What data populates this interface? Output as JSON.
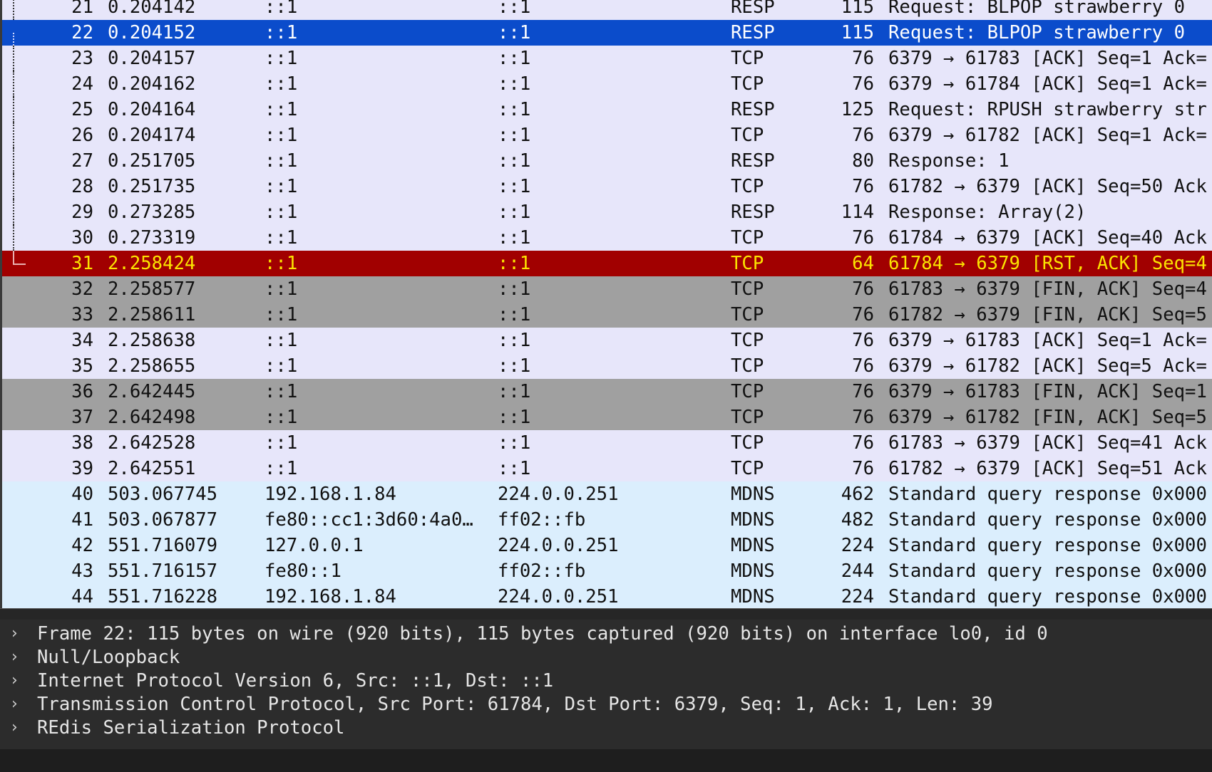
{
  "packets": [
    {
      "no": "21",
      "time": "0.204142",
      "source": "::1",
      "destination": "::1",
      "protocol": "RESP",
      "length": "115",
      "info": "Request: BLPOP strawberry 0",
      "style": "normal"
    },
    {
      "no": "22",
      "time": "0.204152",
      "source": "::1",
      "destination": "::1",
      "protocol": "RESP",
      "length": "115",
      "info": "Request: BLPOP strawberry 0",
      "style": "selected"
    },
    {
      "no": "23",
      "time": "0.204157",
      "source": "::1",
      "destination": "::1",
      "protocol": "TCP",
      "length": "76",
      "info": "6379 → 61783 [ACK] Seq=1 Ack=",
      "style": "normal"
    },
    {
      "no": "24",
      "time": "0.204162",
      "source": "::1",
      "destination": "::1",
      "protocol": "TCP",
      "length": "76",
      "info": "6379 → 61784 [ACK] Seq=1 Ack=",
      "style": "normal"
    },
    {
      "no": "25",
      "time": "0.204164",
      "source": "::1",
      "destination": "::1",
      "protocol": "RESP",
      "length": "125",
      "info": "Request: RPUSH strawberry str",
      "style": "normal"
    },
    {
      "no": "26",
      "time": "0.204174",
      "source": "::1",
      "destination": "::1",
      "protocol": "TCP",
      "length": "76",
      "info": "6379 → 61782 [ACK] Seq=1 Ack=",
      "style": "normal"
    },
    {
      "no": "27",
      "time": "0.251705",
      "source": "::1",
      "destination": "::1",
      "protocol": "RESP",
      "length": "80",
      "info": "Response: 1",
      "style": "normal"
    },
    {
      "no": "28",
      "time": "0.251735",
      "source": "::1",
      "destination": "::1",
      "protocol": "TCP",
      "length": "76",
      "info": "61782 → 6379 [ACK] Seq=50 Ack",
      "style": "normal"
    },
    {
      "no": "29",
      "time": "0.273285",
      "source": "::1",
      "destination": "::1",
      "protocol": "RESP",
      "length": "114",
      "info": "Response: Array(2)",
      "style": "normal"
    },
    {
      "no": "30",
      "time": "0.273319",
      "source": "::1",
      "destination": "::1",
      "protocol": "TCP",
      "length": "76",
      "info": "61784 → 6379 [ACK] Seq=40 Ack",
      "style": "normal"
    },
    {
      "no": "31",
      "time": "2.258424",
      "source": "::1",
      "destination": "::1",
      "protocol": "TCP",
      "length": "64",
      "info": "61784 → 6379 [RST, ACK] Seq=4",
      "style": "rst"
    },
    {
      "no": "32",
      "time": "2.258577",
      "source": "::1",
      "destination": "::1",
      "protocol": "TCP",
      "length": "76",
      "info": "61783 → 6379 [FIN, ACK] Seq=4",
      "style": "finack"
    },
    {
      "no": "33",
      "time": "2.258611",
      "source": "::1",
      "destination": "::1",
      "protocol": "TCP",
      "length": "76",
      "info": "61782 → 6379 [FIN, ACK] Seq=5",
      "style": "finack"
    },
    {
      "no": "34",
      "time": "2.258638",
      "source": "::1",
      "destination": "::1",
      "protocol": "TCP",
      "length": "76",
      "info": "6379 → 61783 [ACK] Seq=1 Ack=",
      "style": "normal"
    },
    {
      "no": "35",
      "time": "2.258655",
      "source": "::1",
      "destination": "::1",
      "protocol": "TCP",
      "length": "76",
      "info": "6379 → 61782 [ACK] Seq=5 Ack=",
      "style": "normal"
    },
    {
      "no": "36",
      "time": "2.642445",
      "source": "::1",
      "destination": "::1",
      "protocol": "TCP",
      "length": "76",
      "info": "6379 → 61783 [FIN, ACK] Seq=1",
      "style": "finack"
    },
    {
      "no": "37",
      "time": "2.642498",
      "source": "::1",
      "destination": "::1",
      "protocol": "TCP",
      "length": "76",
      "info": "6379 → 61782 [FIN, ACK] Seq=5",
      "style": "finack"
    },
    {
      "no": "38",
      "time": "2.642528",
      "source": "::1",
      "destination": "::1",
      "protocol": "TCP",
      "length": "76",
      "info": "61783 → 6379 [ACK] Seq=41 Ack",
      "style": "normal"
    },
    {
      "no": "39",
      "time": "2.642551",
      "source": "::1",
      "destination": "::1",
      "protocol": "TCP",
      "length": "76",
      "info": "61782 → 6379 [ACK] Seq=51 Ack",
      "style": "normal"
    },
    {
      "no": "40",
      "time": "503.067745",
      "source": "192.168.1.84",
      "destination": "224.0.0.251",
      "protocol": "MDNS",
      "length": "462",
      "info": "Standard query response 0x000",
      "style": "mdns"
    },
    {
      "no": "41",
      "time": "503.067877",
      "source": "fe80::cc1:3d60:4a0…",
      "destination": "ff02::fb",
      "protocol": "MDNS",
      "length": "482",
      "info": "Standard query response 0x000",
      "style": "mdns"
    },
    {
      "no": "42",
      "time": "551.716079",
      "source": "127.0.0.1",
      "destination": "224.0.0.251",
      "protocol": "MDNS",
      "length": "224",
      "info": "Standard query response 0x000",
      "style": "mdns"
    },
    {
      "no": "43",
      "time": "551.716157",
      "source": "fe80::1",
      "destination": "ff02::fb",
      "protocol": "MDNS",
      "length": "244",
      "info": "Standard query response 0x000",
      "style": "mdns"
    },
    {
      "no": "44",
      "time": "551.716228",
      "source": "192.168.1.84",
      "destination": "224.0.0.251",
      "protocol": "MDNS",
      "length": "224",
      "info": "Standard query response 0x000",
      "style": "mdns"
    }
  ],
  "details": [
    {
      "text": "Frame 22: 115 bytes on wire (920 bits), 115 bytes captured (920 bits) on interface lo0, id 0",
      "icon": "chevron-right-icon"
    },
    {
      "text": "Null/Loopback",
      "icon": "chevron-right-icon"
    },
    {
      "text": "Internet Protocol Version 6, Src: ::1, Dst: ::1",
      "icon": "chevron-right-icon"
    },
    {
      "text": "Transmission Control Protocol, Src Port: 61784, Dst Port: 6379, Seq: 1, Ack: 1, Len: 39",
      "icon": "chevron-right-icon"
    },
    {
      "text": "REdis Serialization Protocol",
      "icon": "chevron-right-icon"
    }
  ],
  "colors": {
    "normal": "#e7e6fa",
    "selected": "#0b4ccb",
    "rst": "#a10000",
    "rst_text": "#fbe400",
    "finack": "#a0a0a0",
    "mdns": "#dbeefd",
    "details_bg": "#2c2c2c"
  }
}
